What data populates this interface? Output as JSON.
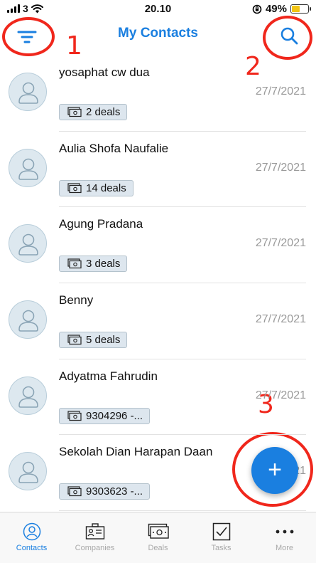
{
  "status_bar": {
    "carrier": "3",
    "time": "20.10",
    "battery_percent": "49%",
    "battery_level": 0.49
  },
  "header": {
    "title": "My Contacts"
  },
  "annotations": {
    "filter": "1",
    "search": "2",
    "add": "3"
  },
  "contacts": [
    {
      "name": "yosaphat cw dua",
      "date": "27/7/2021",
      "deals": "2 deals"
    },
    {
      "name": "Aulia Shofa Naufalie",
      "date": "27/7/2021",
      "deals": "14 deals"
    },
    {
      "name": "Agung Pradana",
      "date": "27/7/2021",
      "deals": "3 deals"
    },
    {
      "name": "Benny",
      "date": "27/7/2021",
      "deals": "5 deals"
    },
    {
      "name": "Adyatma Fahrudin",
      "date": "27/7/2021",
      "deals": "9304296 -..."
    },
    {
      "name": "Sekolah Dian Harapan Daan",
      "date": "27/7/2021",
      "deals": "9303623 -..."
    }
  ],
  "fab": {
    "label": "+"
  },
  "tabs": [
    {
      "label": "Contacts",
      "icon": "person-circle-icon",
      "active": true
    },
    {
      "label": "Companies",
      "icon": "company-card-icon",
      "active": false
    },
    {
      "label": "Deals",
      "icon": "money-icon",
      "active": false
    },
    {
      "label": "Tasks",
      "icon": "checkbox-icon",
      "active": false
    },
    {
      "label": "More",
      "icon": "ellipsis-icon",
      "active": false
    }
  ],
  "colors": {
    "accent": "#1a7fe0",
    "annotation": "#f0271c",
    "badge_bg": "#dde6ee",
    "date": "#9a9a9a"
  }
}
